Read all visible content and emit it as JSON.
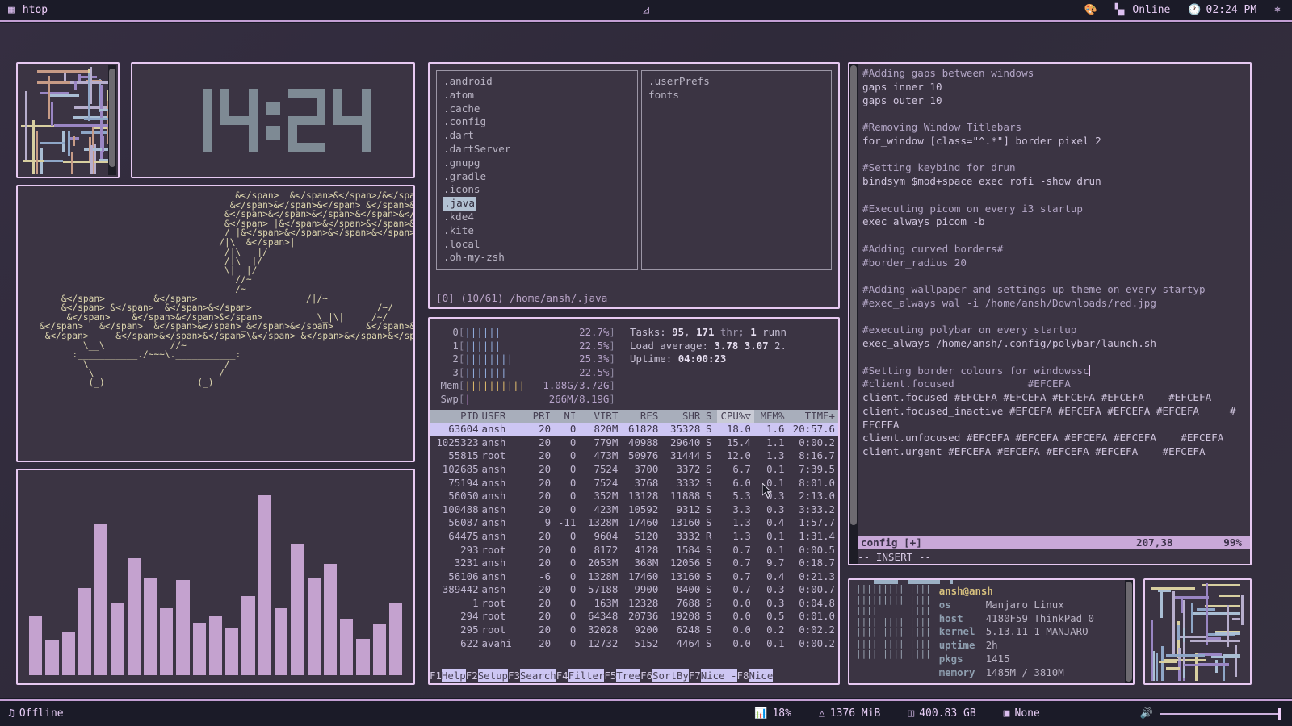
{
  "topbar": {
    "menu_icon": "grid-icon",
    "window_title": "htop",
    "center_icon": "layout-icon",
    "palette_icon": "palette-icon",
    "network_icon": "signal-icon",
    "network_label": "Online",
    "clock_icon": "clock-icon",
    "clock_label": "02:24 PM",
    "power_icon": "power-icon"
  },
  "bottombar": {
    "music_icon": "music-note-icon",
    "music_label": "Offline",
    "cpu_icon": "cpu-chart-icon",
    "cpu_label": "18%",
    "mem_icon": "memory-icon",
    "mem_label": "1376 MiB",
    "disk_icon": "disk-icon",
    "disk_label": "400.83 GB",
    "package_icon": "package-icon",
    "package_label": "None",
    "volume_icon": "volume-icon",
    "volume_value": 100
  },
  "clock_widget": {
    "time": "14:24",
    "hh": "14",
    "mm": "24"
  },
  "ascii_art": {
    "lines": [
      "                                        &  &&/&&  &&&&",
      "                                       &&& &&&&&&&&&",
      "                                      &&&&&&&&&&&&&",
      "                                      & |&&&&&&",
      "                                      / |&&&&&&&&",
      "                                     /|\\  &|",
      "                                      /|\\   |/",
      "                                      /|\\  |/",
      "                                      \\|  |/",
      "                                        //~",
      "                                        /~",
      "        &         &                    /|/~",
      "        & &  &&                       /~/",
      "         &    &&&          \\_|\\|     /~/",
      "    &   &  &&_&&      && \\\\   \\|    /~\\",
      "     &     &&&\\& &&&&_        \\____~",
      "            \\__\\            //~",
      "          :___________./~~~\\.___________:",
      "            \\                         /",
      "             \\_______________________/",
      "             (_)                 (_)"
    ]
  },
  "bar_chart": {
    "values": [
      26,
      14,
      18,
      40,
      72,
      33,
      55,
      45,
      30,
      44,
      23,
      26,
      20,
      36,
      86,
      30,
      62,
      45,
      52,
      25,
      15,
      22,
      33
    ],
    "color": "#c4a2cf"
  },
  "ranger": {
    "left_column": [
      ".android",
      ".atom",
      ".cache",
      ".config",
      ".dart",
      ".dartServer",
      ".gnupg",
      ".gradle",
      ".icons",
      ".java",
      ".kde4",
      ".kite",
      ".local",
      ".oh-my-zsh"
    ],
    "selected_index": 9,
    "right_column": [
      ".userPrefs",
      "fonts"
    ],
    "status": "[0] (10/61) /home/ansh/.java"
  },
  "htop": {
    "cpus": [
      {
        "id": "0",
        "bars": 6,
        "pct": "22.7%"
      },
      {
        "id": "1",
        "bars": 6,
        "pct": "22.5%"
      },
      {
        "id": "2",
        "bars": 8,
        "pct": "25.3%"
      },
      {
        "id": "3",
        "bars": 7,
        "pct": "22.5%"
      }
    ],
    "mem": {
      "label": "Mem",
      "bars": 10,
      "value": "1.08G/3.72G",
      "used": "1.08",
      "total": "3.72G"
    },
    "swp": {
      "label": "Swp",
      "bars": 1,
      "value": "266M/8.19G"
    },
    "tasks_label": "Tasks:",
    "tasks_count": "95",
    "threads": "171",
    "threads_label": "thr;",
    "running": "1",
    "running_label": "runn",
    "load_label": "Load average:",
    "load1": "3.78",
    "load5": "3.07",
    "load15": "2.",
    "uptime_label": "Uptime:",
    "uptime": "04:00:23",
    "columns": [
      "PID",
      "USER",
      "PRI",
      "NI",
      "VIRT",
      "RES",
      "SHR",
      "S",
      "CPU%▽",
      "MEM%",
      "TIME+"
    ],
    "sort_column": "CPU%",
    "rows": [
      {
        "pid": "63604",
        "user": "ansh",
        "pri": "20",
        "ni": "0",
        "virt": "820M",
        "res": "61828",
        "shr": "35328",
        "s": "S",
        "cpu": "18.0",
        "mem": "1.6",
        "time": "20:57.6",
        "selected": true
      },
      {
        "pid": "1025323",
        "user": "ansh",
        "pri": "20",
        "ni": "0",
        "virt": "779M",
        "res": "40988",
        "shr": "29640",
        "s": "S",
        "cpu": "15.4",
        "mem": "1.1",
        "time": "0:00.2"
      },
      {
        "pid": "55815",
        "user": "root",
        "pri": "20",
        "ni": "0",
        "virt": "473M",
        "res": "50976",
        "shr": "31444",
        "s": "S",
        "cpu": "12.0",
        "mem": "1.3",
        "time": "8:16.7"
      },
      {
        "pid": "102685",
        "user": "ansh",
        "pri": "20",
        "ni": "0",
        "virt": "7524",
        "res": "3700",
        "shr": "3372",
        "s": "S",
        "cpu": "6.7",
        "mem": "0.1",
        "time": "7:39.5"
      },
      {
        "pid": "75194",
        "user": "ansh",
        "pri": "20",
        "ni": "0",
        "virt": "7524",
        "res": "3768",
        "shr": "3332",
        "s": "S",
        "cpu": "6.0",
        "mem": "0.1",
        "time": "8:01.0"
      },
      {
        "pid": "56050",
        "user": "ansh",
        "pri": "20",
        "ni": "0",
        "virt": "352M",
        "res": "13128",
        "shr": "11888",
        "s": "S",
        "cpu": "5.3",
        "mem": "0.3",
        "time": "2:13.0"
      },
      {
        "pid": "100488",
        "user": "ansh",
        "pri": "20",
        "ni": "0",
        "virt": "423M",
        "res": "10592",
        "shr": "9312",
        "s": "S",
        "cpu": "3.3",
        "mem": "0.3",
        "time": "3:33.2"
      },
      {
        "pid": "56087",
        "user": "ansh",
        "pri": "9",
        "ni": "-11",
        "virt": "1328M",
        "res": "17460",
        "shr": "13160",
        "s": "S",
        "cpu": "1.3",
        "mem": "0.4",
        "time": "1:57.7"
      },
      {
        "pid": "64475",
        "user": "ansh",
        "pri": "20",
        "ni": "0",
        "virt": "9604",
        "res": "5120",
        "shr": "3332",
        "s": "R",
        "cpu": "1.3",
        "mem": "0.1",
        "time": "1:31.4"
      },
      {
        "pid": "293",
        "user": "root",
        "pri": "20",
        "ni": "0",
        "virt": "8172",
        "res": "4128",
        "shr": "1584",
        "s": "S",
        "cpu": "0.7",
        "mem": "0.1",
        "time": "0:00.5"
      },
      {
        "pid": "3231",
        "user": "ansh",
        "pri": "20",
        "ni": "0",
        "virt": "2053M",
        "res": "368M",
        "shr": "12056",
        "s": "S",
        "cpu": "0.7",
        "mem": "9.7",
        "time": "0:18.7"
      },
      {
        "pid": "56106",
        "user": "ansh",
        "pri": "-6",
        "ni": "0",
        "virt": "1328M",
        "res": "17460",
        "shr": "13160",
        "s": "S",
        "cpu": "0.7",
        "mem": "0.4",
        "time": "0:21.3"
      },
      {
        "pid": "389442",
        "user": "ansh",
        "pri": "20",
        "ni": "0",
        "virt": "57188",
        "res": "9900",
        "shr": "8400",
        "s": "S",
        "cpu": "0.7",
        "mem": "0.3",
        "time": "0:00.7"
      },
      {
        "pid": "1",
        "user": "root",
        "pri": "20",
        "ni": "0",
        "virt": "163M",
        "res": "12328",
        "shr": "7688",
        "s": "S",
        "cpu": "0.0",
        "mem": "0.3",
        "time": "0:04.8"
      },
      {
        "pid": "294",
        "user": "root",
        "pri": "20",
        "ni": "0",
        "virt": "64348",
        "res": "20736",
        "shr": "19208",
        "s": "S",
        "cpu": "0.0",
        "mem": "0.5",
        "time": "0:01.0"
      },
      {
        "pid": "295",
        "user": "root",
        "pri": "20",
        "ni": "0",
        "virt": "32028",
        "res": "9200",
        "shr": "6248",
        "s": "S",
        "cpu": "0.0",
        "mem": "0.2",
        "time": "0:02.2"
      },
      {
        "pid": "622",
        "user": "avahi",
        "pri": "20",
        "ni": "0",
        "virt": "12732",
        "res": "5152",
        "shr": "4464",
        "s": "S",
        "cpu": "0.0",
        "mem": "0.1",
        "time": "0:00.2"
      }
    ],
    "fnkeys": [
      {
        "key": "F1",
        "label": "Help  "
      },
      {
        "key": "F2",
        "label": "Setup "
      },
      {
        "key": "F3",
        "label": "Search"
      },
      {
        "key": "F4",
        "label": "Filter"
      },
      {
        "key": "F5",
        "label": "Tree  "
      },
      {
        "key": "F6",
        "label": "SortBy"
      },
      {
        "key": "F7",
        "label": "Nice -"
      },
      {
        "key": "F8",
        "label": "Nice "
      }
    ]
  },
  "vim": {
    "lines": [
      {
        "t": "#Adding gaps between windows",
        "k": "cm"
      },
      {
        "t": "gaps inner 10"
      },
      {
        "t": "gaps outer 10"
      },
      {
        "t": ""
      },
      {
        "t": "#Removing Window Titlebars",
        "k": "cm"
      },
      {
        "t": "for_window [class=\"^.*\"] border pixel 2"
      },
      {
        "t": ""
      },
      {
        "t": "#Setting keybind for drun",
        "k": "cm"
      },
      {
        "t": "bindsym $mod+space exec rofi -show drun"
      },
      {
        "t": ""
      },
      {
        "t": "#Executing picom on every i3 startup",
        "k": "cm"
      },
      {
        "t": "exec_always picom -b"
      },
      {
        "t": ""
      },
      {
        "t": "#Adding curved borders#",
        "k": "cm"
      },
      {
        "t": "#border_radius 20",
        "k": "cm"
      },
      {
        "t": ""
      },
      {
        "t": "#Adding wallpaper and settings up theme on every startyp",
        "k": "cm"
      },
      {
        "t": "#exec_always wal -i /home/ansh/Downloads/red.jpg",
        "k": "cm"
      },
      {
        "t": ""
      },
      {
        "t": "#executing polybar on every startup",
        "k": "cm"
      },
      {
        "t": "exec_always /home/ansh/.config/polybar/launch.sh"
      },
      {
        "t": ""
      },
      {
        "t": "#Setting border colours for windowssc",
        "k": "cm",
        "cursor": true
      },
      {
        "t": "#client.focused            #EFCEFA",
        "k": "cm"
      },
      {
        "t": "client.focused #EFCEFA #EFCEFA #EFCEFA #EFCEFA    #EFCEFA"
      },
      {
        "t": "client.focused_inactive #EFCEFA #EFCEFA #EFCEFA #EFCEFA     #"
      },
      {
        "t": "EFCEFA"
      },
      {
        "t": "client.unfocused #EFCEFA #EFCEFA #EFCEFA #EFCEFA    #EFCEFA"
      },
      {
        "t": "client.urgent #EFCEFA #EFCEFA #EFCEFA #EFCEFA    #EFCEFA"
      }
    ],
    "status_file": "config [+]",
    "status_pos": "207,38",
    "status_pct": "99%",
    "mode": "-- INSERT --"
  },
  "neofetch": {
    "title": "ansh@ansh",
    "logo": [
      "||||||||| ||||",
      "||||||||| ||||",
      "||||      ||||",
      "|||| |||| ||||",
      "|||| |||| ||||",
      "|||| |||| ||||",
      "|||| |||| ||||"
    ],
    "rows": [
      {
        "key": "os",
        "value": "Manjaro Linux"
      },
      {
        "key": "host",
        "value": "4180F59 ThinkPad 0"
      },
      {
        "key": "kernel",
        "value": "5.13.11-1-MANJARO"
      },
      {
        "key": "uptime",
        "value": "2h"
      },
      {
        "key": "pkgs",
        "value": "1415"
      },
      {
        "key": "memory",
        "value": "1485M / 3810M"
      }
    ]
  },
  "theme": {
    "accent": "#efcefa",
    "border": "#e7c9f2",
    "bg": "#2e2838",
    "window_bg": "#3b3443",
    "bar_bg": "#1b1b28"
  }
}
